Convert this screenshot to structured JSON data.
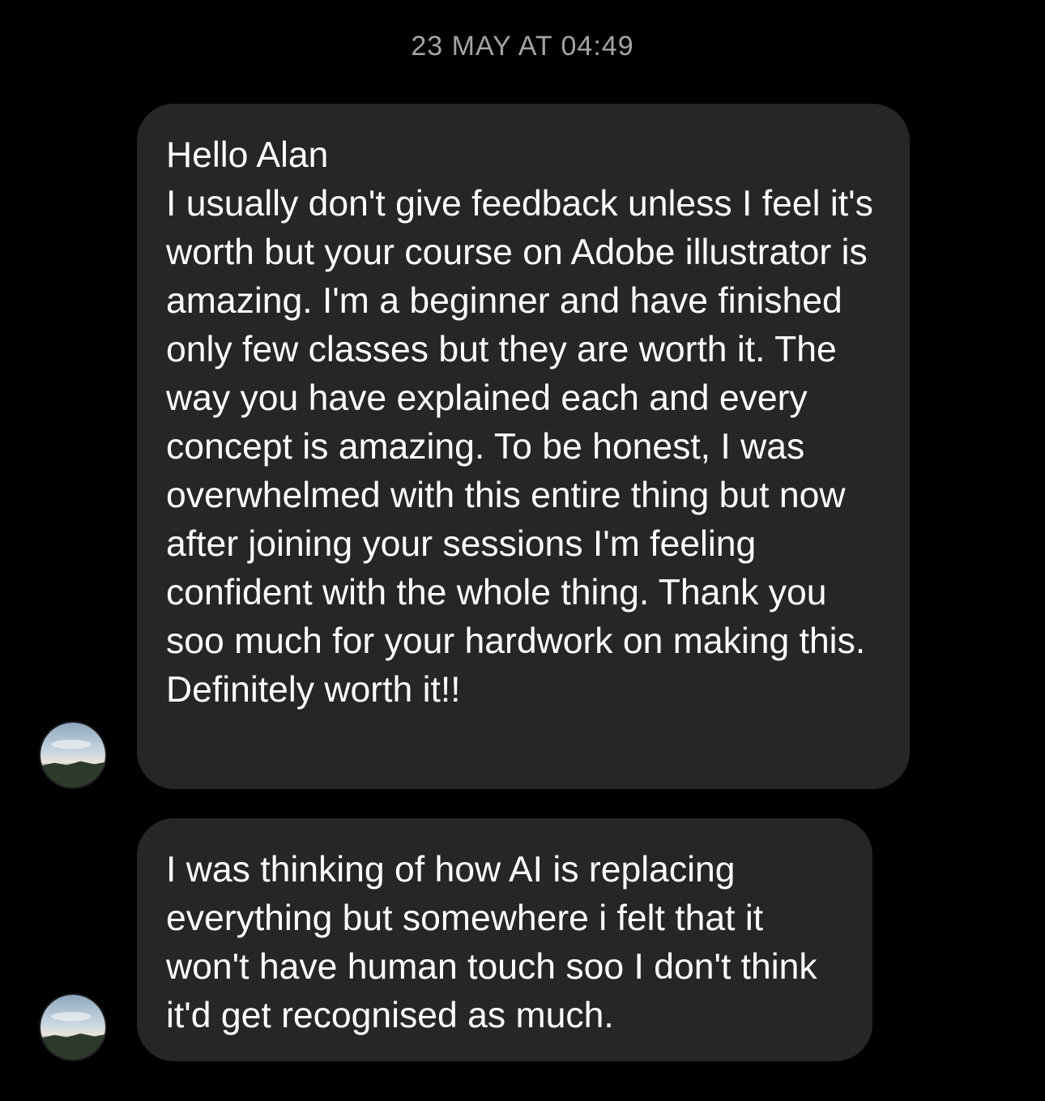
{
  "chat": {
    "timestamp": "23 MAY AT 04:49",
    "messages": [
      {
        "paragraphs": [
          "Hello Alan",
          "I usually don't give feedback unless I feel it's worth but your course on Adobe illustrator is amazing. I'm a beginner and have finished only few classes but they are worth it. The way you have explained each and every concept is amazing. To be honest, I was overwhelmed with this entire thing but now after joining your sessions I'm feeling confident with the whole thing. Thank you soo much for your hardwork on making this. Definitely worth it!!"
        ]
      },
      {
        "paragraphs": [
          "I was thinking of how AI is replacing everything but somewhere i felt that it won't have human touch soo I don't think it'd get recognised as much."
        ]
      }
    ]
  },
  "colors": {
    "background": "#000000",
    "bubble": "#262628",
    "timestamp_text": "#a4a4a8",
    "message_text": "#ffffff"
  },
  "icons": {
    "avatar": "profile-avatar-landscape-photo"
  }
}
